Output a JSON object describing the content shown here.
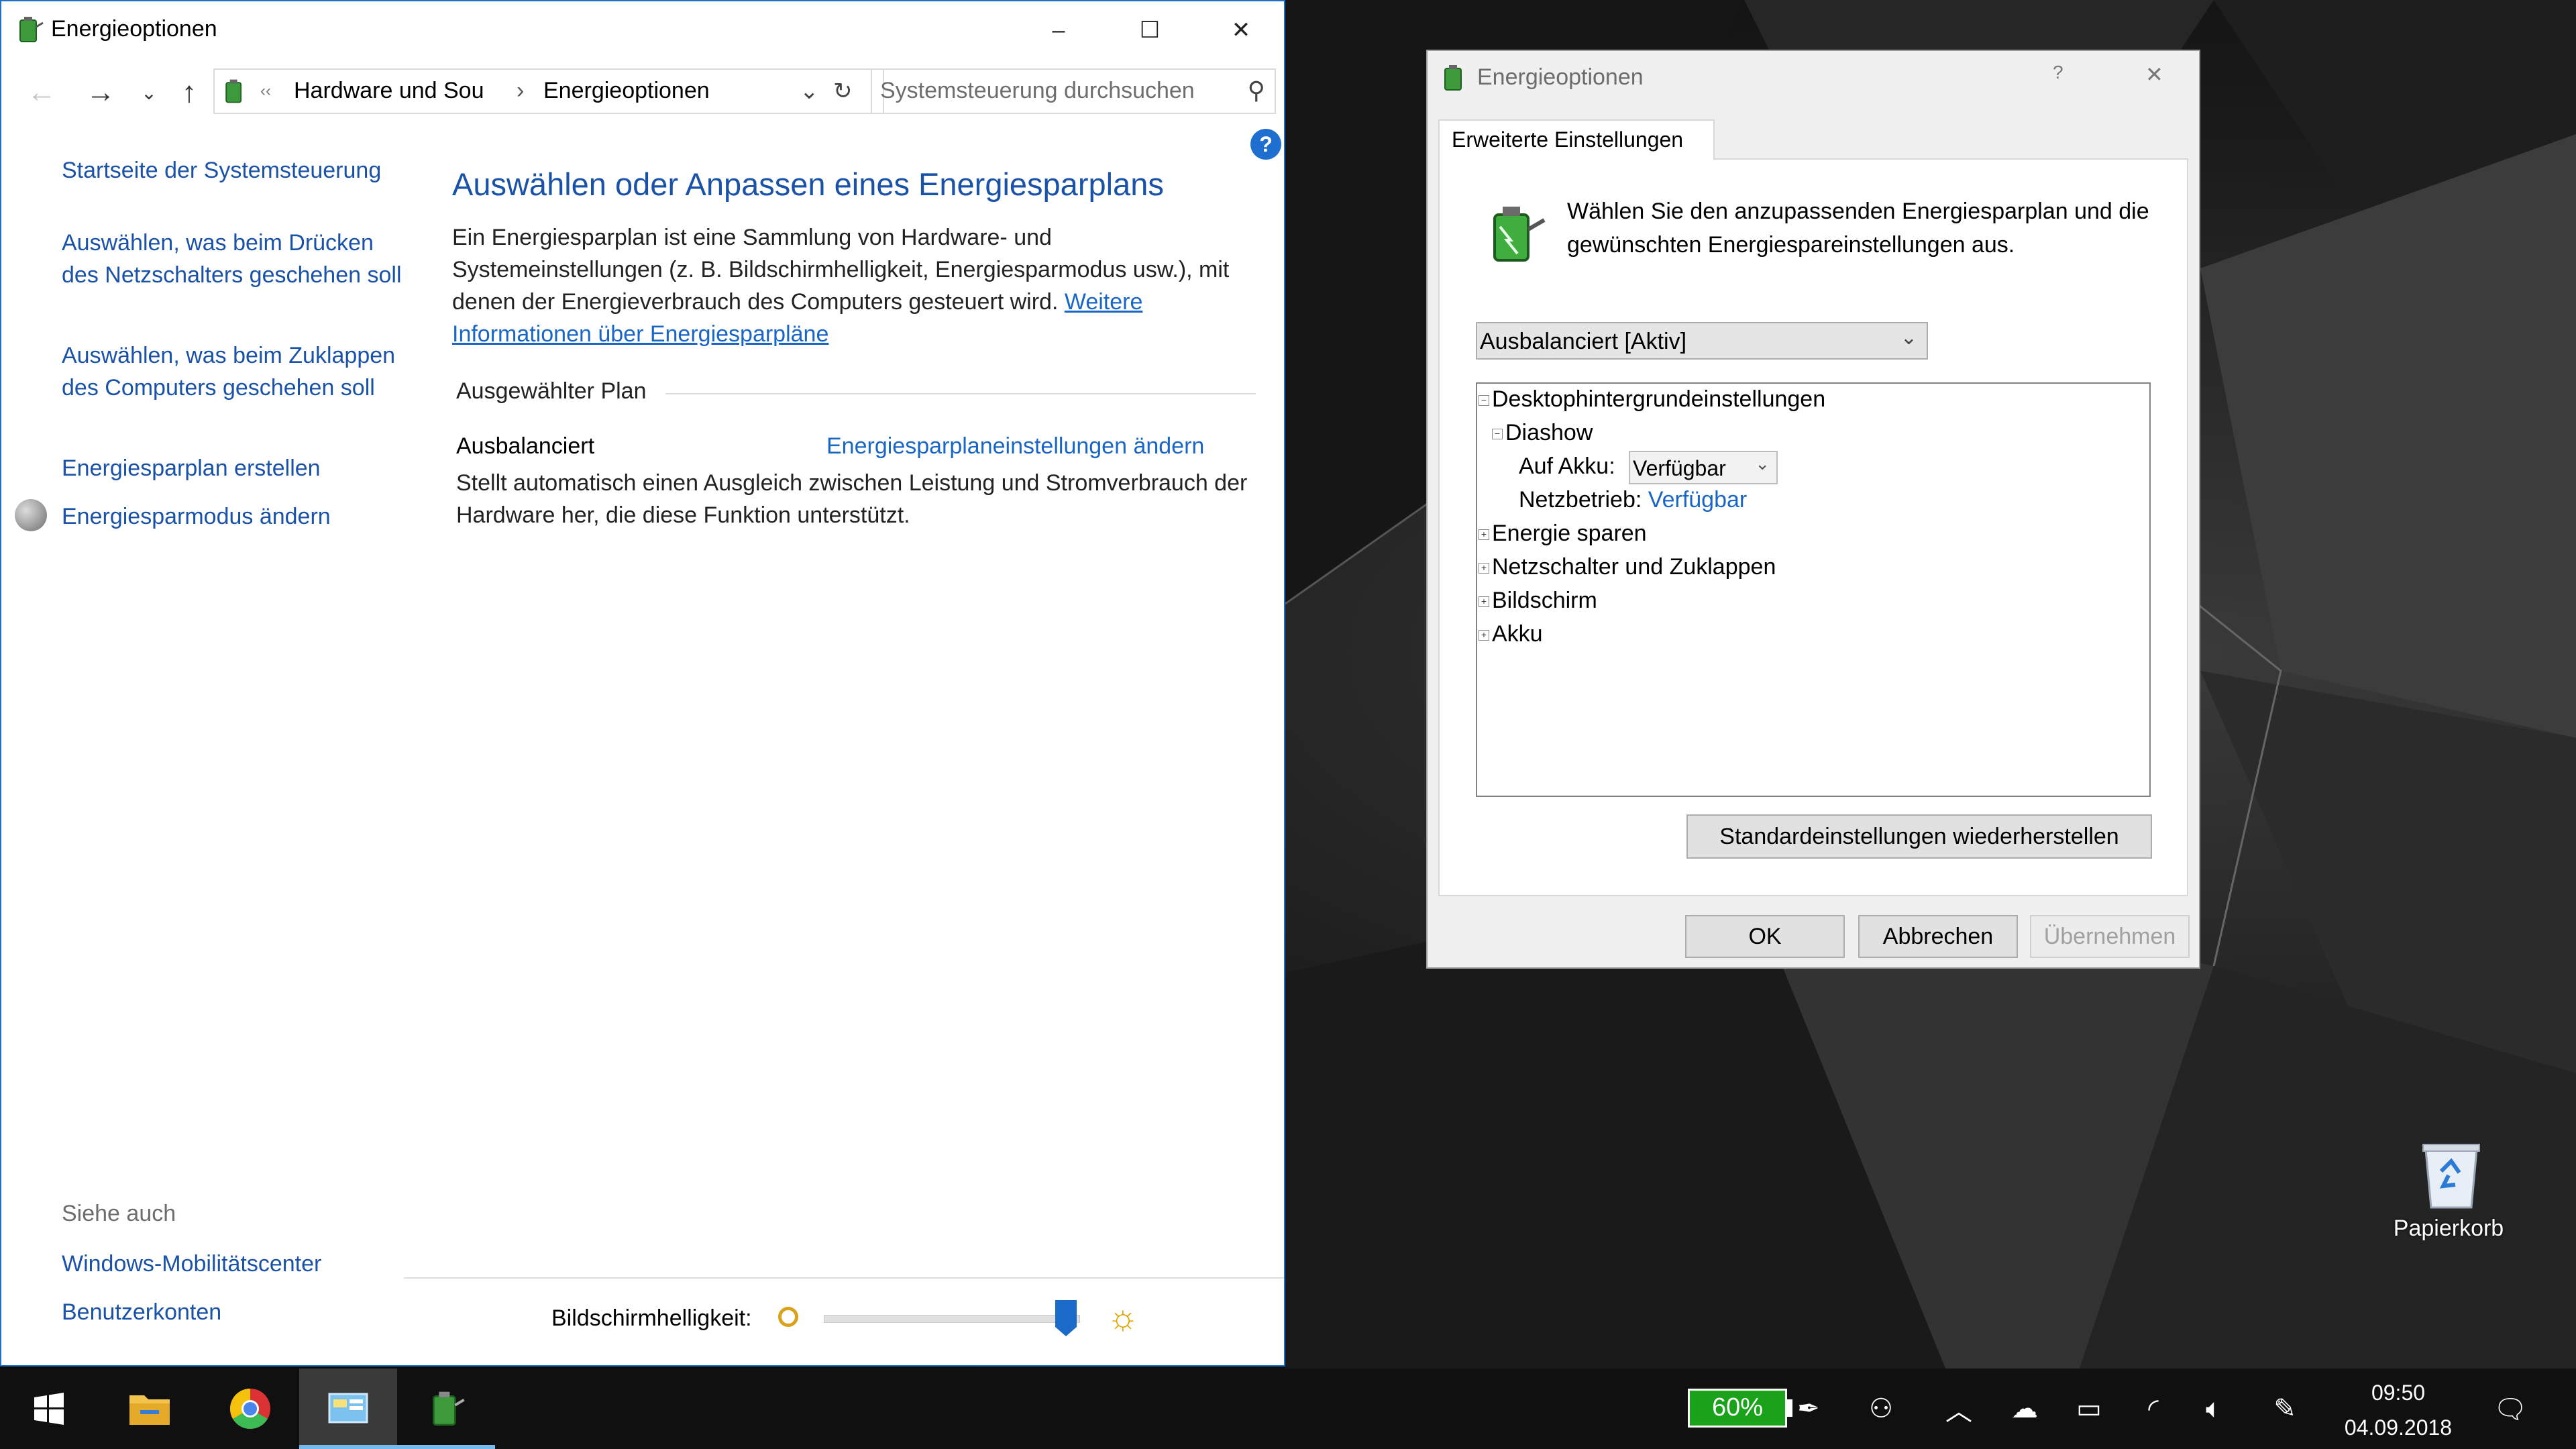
{
  "main_window": {
    "title": "Energieoptionen",
    "caption_minimize": "–",
    "caption_maximize": "☐",
    "caption_close": "✕",
    "address": {
      "crumb_1": "Hardware und Sou",
      "separator": "›",
      "crumb_2": "Energieoptionen",
      "search_placeholder": "Systemsteuerung durchsuchen"
    },
    "sidebar": {
      "home_link": "Startseite der Systemsteuerung",
      "links": [
        "Auswählen, was beim Drücken des Netzschalters geschehen soll",
        "Auswählen, was beim Zuklappen des Computers geschehen soll",
        "Energiesparplan erstellen",
        "Energiesparmodus ändern"
      ],
      "see_also_heading": "Siehe auch",
      "see_also": [
        "Windows-Mobilitätscenter",
        "Benutzerkonten"
      ]
    },
    "content": {
      "title": "Auswählen oder Anpassen eines Energiesparplans",
      "description": "Ein Energiesparplan ist eine Sammlung von Hardware- und Systemeinstellungen (z. B. Bildschirmhelligkeit, Energiesparmodus usw.), mit denen der Energieverbrauch des Computers gesteuert wird.",
      "more_link": "Weitere Informationen über Energiesparpläne",
      "group_heading": "Ausgewählter Plan",
      "plan_name": "Ausbalanciert",
      "plan_link": "Energiesparplaneinstellungen ändern",
      "plan_description": "Stellt automatisch einen Ausgleich zwischen Leistung und Stromverbrauch der Hardware her, die diese Funktion unterstützt.",
      "brightness_label": "Bildschirmhelligkeit:",
      "brightness_level": 0.95
    }
  },
  "dialog": {
    "title": "Energieoptionen",
    "help": "?",
    "close": "✕",
    "tab": "Erweiterte Einstellungen",
    "intro": "Wählen Sie den anzupassenden Energiesparplan und die gewünschten Energiespareinstellungen aus.",
    "plan_select": "Ausbalanciert [Aktiv]",
    "tree": {
      "root": "Desktophintergrundeinstellungen",
      "child": "Diashow",
      "on_battery_label": "Auf Akku:",
      "on_battery_value": "Verfügbar",
      "plugged_label": "Netzbetrieb:",
      "plugged_value": "Verfügbar",
      "collapsed": [
        "Energie sparen",
        "Netzschalter und Zuklappen",
        "Bildschirm",
        "Akku"
      ]
    },
    "restore_button": "Standardeinstellungen wiederherstellen",
    "ok": "OK",
    "cancel": "Abbrechen",
    "apply": "Übernehmen"
  },
  "desktop": {
    "recycle_bin": "Papierkorb"
  },
  "taskbar": {
    "battery_percent": "60%",
    "time": "09:50",
    "date": "04.09.2018"
  }
}
